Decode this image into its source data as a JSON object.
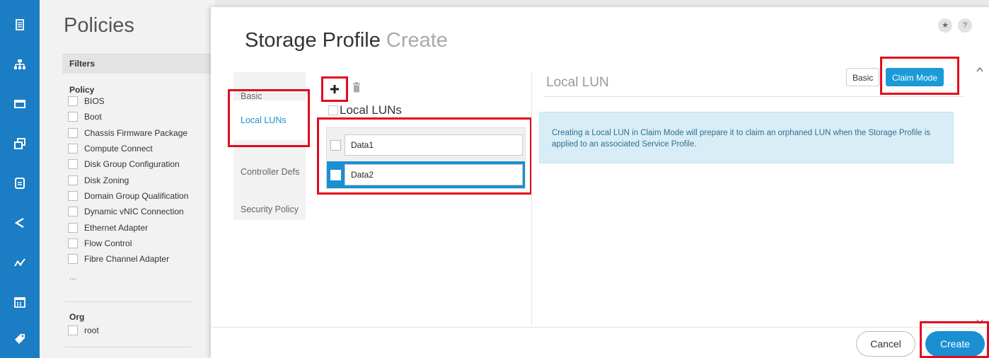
{
  "rail": {
    "icons": [
      "server-icon",
      "network-icon",
      "screen-icon",
      "copy-icon",
      "document-icon",
      "share-icon",
      "analytics-icon",
      "calendar-icon",
      "tag-icon"
    ]
  },
  "policies": {
    "title": "Policies",
    "filters_label": "Filters",
    "policy_section": "Policy",
    "items": [
      "BIOS",
      "Boot",
      "Chassis Firmware Package",
      "Compute Connect",
      "Disk Group Configuration",
      "Disk Zoning",
      "Domain Group Qualification",
      "Dynamic vNIC Connection",
      "Ethernet Adapter",
      "Flow Control",
      "Fibre Channel Adapter"
    ],
    "more": "...",
    "org_section": "Org",
    "org_items": [
      "root"
    ]
  },
  "dialog": {
    "title": "Storage Profile",
    "subtitle": "Create",
    "tabs": [
      "Basic",
      "Local LUNs",
      "Controller Defs",
      "Security Policy"
    ],
    "active_tab": "Local LUNs",
    "luns_heading": "Local LUNs",
    "luns": [
      "Data1",
      "Data2"
    ],
    "selected_lun": "Data2",
    "section_title": "Local LUN",
    "mode_basic": "Basic",
    "mode_claim": "Claim Mode",
    "info_text": "Creating a Local LUN in Claim Mode will prepare it to claim an orphaned LUN when the Storage Profile is applied to an associated Service Profile.",
    "cancel_label": "Cancel",
    "create_label": "Create"
  },
  "colors": {
    "rail": "#1b7dc3",
    "accent": "#1b8fd2",
    "highlight": "#e20c1e",
    "info_bg": "#d9edf7"
  }
}
